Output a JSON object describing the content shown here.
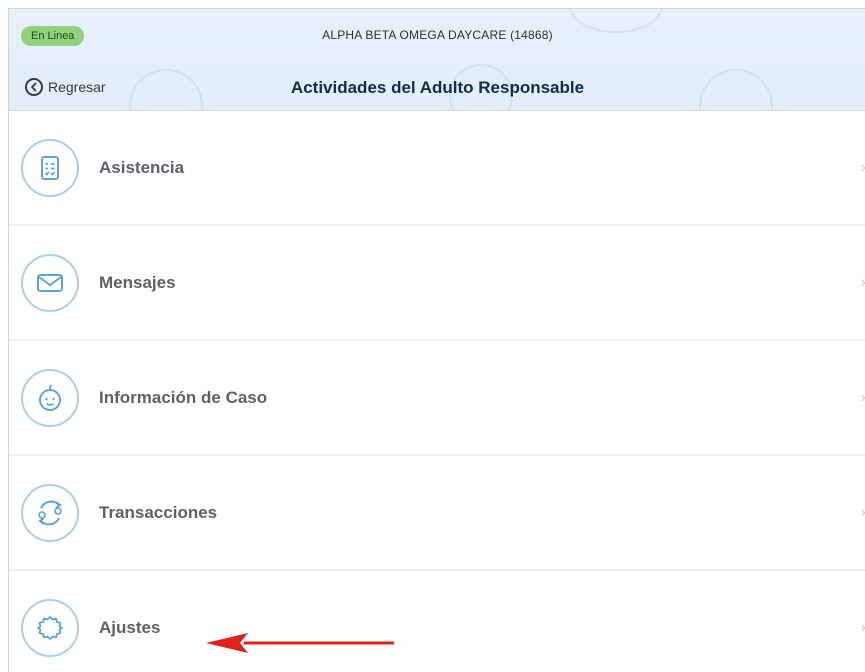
{
  "header": {
    "status_badge": "En Linea",
    "center_title": "ALPHA BETA OMEGA DAYCARE (14868)",
    "back_label": "Regresar",
    "page_title": "Actividades del Adulto Responsable"
  },
  "menu": {
    "items": [
      {
        "label": "Asistencia",
        "icon": "attendance-checklist-icon"
      },
      {
        "label": "Mensajes",
        "icon": "envelope-icon"
      },
      {
        "label": "Información de Caso",
        "icon": "baby-face-icon"
      },
      {
        "label": "Transacciones",
        "icon": "exchange-cycle-icon"
      },
      {
        "label": "Ajustes",
        "icon": "gear-icon"
      }
    ],
    "chevron": "›"
  },
  "colors": {
    "header_bg": "#e4eef8",
    "status_green": "#8fd17c",
    "icon_blue": "#5aa3e0",
    "annotation_arrow": "#e0201b"
  }
}
